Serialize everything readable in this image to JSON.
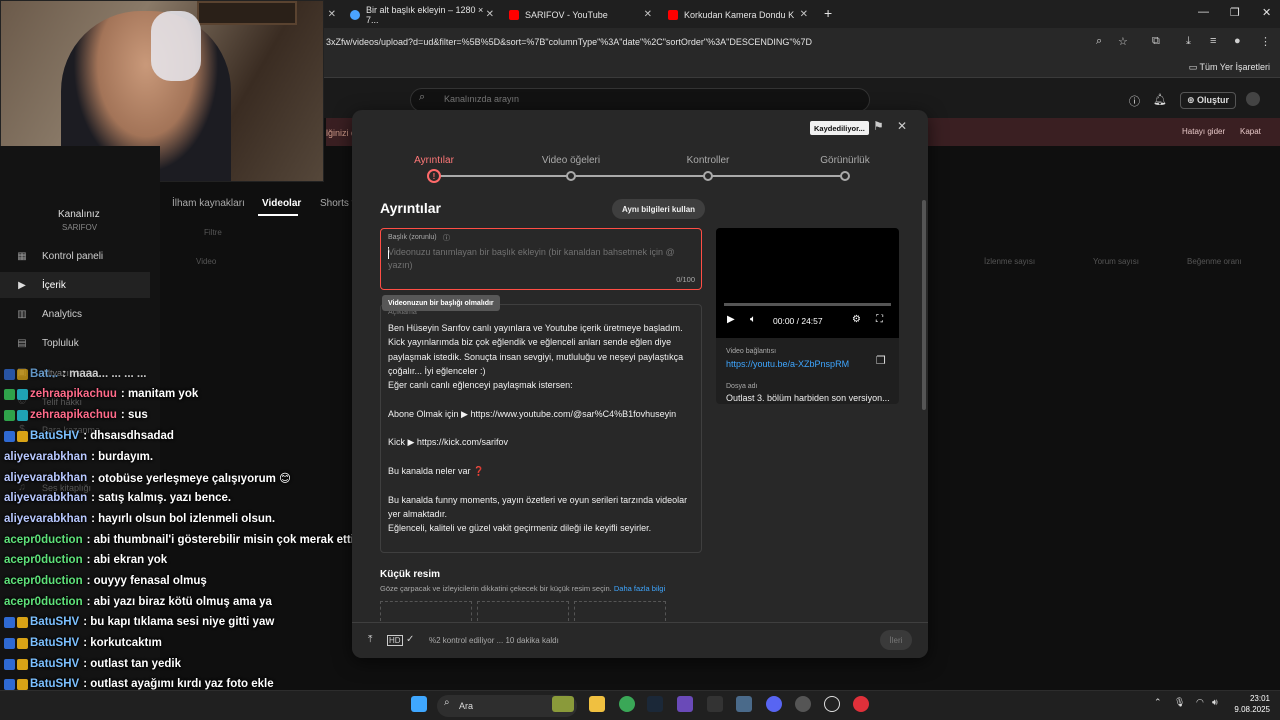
{
  "browser": {
    "tabs": [
      {
        "title": "Bir alt başlık ekleyin – 1280 × 7...",
        "fav_color": "#4aa3ff"
      },
      {
        "title": "SARIFOV - YouTube",
        "fav_color": "#ff0000"
      },
      {
        "title": "Korkudan Kamera Dondu Klavy...",
        "fav_color": "#ff0000"
      }
    ],
    "url": "3xZfw/videos/upload?d=ud&filter=%5B%5D&sort=%7B\"columnType\"%3A\"date\"%2C\"sortOrder\"%3A\"DESCENDING\"%7D",
    "bookmarks_all": "Tüm Yer İşaretleri"
  },
  "studio": {
    "search_placeholder": "Kanalınızda arayın",
    "create_label": "Oluştur",
    "banner_text": "lğinizi d",
    "banner_fix": "Hatayı gider",
    "banner_close": "Kapat",
    "channel_title": "Kanalınız",
    "channel_name": "SARIFOV",
    "content_tabs": [
      "İlham kaynakları",
      "Videolar",
      "Shorts v"
    ],
    "filter": "Filtre",
    "table_headers": [
      "Video",
      "İzlenme sayısı",
      "Yorum sayısı",
      "Beğenme oranı"
    ],
    "sidebar": [
      {
        "label": "Kontrol paneli"
      },
      {
        "label": "İçerik"
      },
      {
        "label": "Analytics"
      },
      {
        "label": "Topluluk"
      },
      {
        "label": "Altyazı ve ses"
      },
      {
        "label": "Telif hakkı"
      },
      {
        "label": "Para kazanma"
      },
      {
        "label": "Ses kitaplığı"
      }
    ]
  },
  "chat": [
    {
      "user": "Bat...",
      "msg": ": maaa... ... ... ..."
    },
    {
      "user": "zehraapikachuu",
      "msg": ": manitam yok"
    },
    {
      "user": "zehraapikachuu",
      "msg": ": sus"
    },
    {
      "user": "BatuSHV",
      "msg": ": dhsaısdhsadad"
    },
    {
      "user": "aliyevarabkhan",
      "msg": ": burdayım."
    },
    {
      "user": "aliyevarabkhan",
      "msg": ": otobüse yerleşmeye çalışıyorum 😊"
    },
    {
      "user": "aliyevarabkhan",
      "msg": ": satış kalmış. yazı bence."
    },
    {
      "user": "aliyevarabkhan",
      "msg": ": hayırlı olsun bol izlenmeli olsun."
    },
    {
      "user": "acepr0duction",
      "msg": ": abi thumbnail'i gösterebilir misin çok merak ettim"
    },
    {
      "user": "acepr0duction",
      "msg": ": abi ekran yok"
    },
    {
      "user": "acepr0duction",
      "msg": ": ouyyy fenasal olmuş"
    },
    {
      "user": "acepr0duction",
      "msg": ": abi yazı biraz kötü olmuş ama ya"
    },
    {
      "user": "BatuSHV",
      "msg": ": bu kapı tıklama sesi niye gitti yaw"
    },
    {
      "user": "BatuSHV",
      "msg": ": korkutcaktım"
    },
    {
      "user": "BatuSHV",
      "msg": ": outlast tan yedik"
    },
    {
      "user": "BatuSHV",
      "msg": ": outlast ayağımı kırdı yaz foto ekle"
    }
  ],
  "modal": {
    "saving_badge": "Kaydediliyor...",
    "steps": [
      "Ayrıntılar",
      "Video öğeleri",
      "Kontroller",
      "Görünürlük"
    ],
    "heading": "Ayrıntılar",
    "reuse_button": "Aynı bilgileri kullan",
    "title_field": {
      "label": "Başlık (zorunlu)",
      "placeholder": "Videonuzu tanımlayan bir başlık ekleyin (bir kanaldan bahsetmek için @ yazın)",
      "count": "0/100"
    },
    "title_error_tooltip": "Videonuzun bir başlığı olmalıdır",
    "description_label": "Açıklama",
    "description_text": "Ben Hüseyin Sarıfov canlı yayınlara ve Youtube içerik üretmeye başladım. Kick yayınlarımda biz çok eğlendik ve eğlenceli anları sende eğlen diye paylaşmak istedik. Sonuçta insan sevgiyi, mutluluğu ve neşeyi paylaştıkça çoğalır... İyi eğlenceler :)\nEğer canlı canlı eğlenceyi paylaşmak istersen:\n\nAbone Olmak için ▶ https://www.youtube.com/@sar%C4%B1fovhuseyin\n\nKick ▶ https://kick.com/sarifov\n\nBu kanalda neler var ❓\n\nBu kanalda funny moments, yayın özetleri ve oyun serileri tarzında videolar yer almaktadır.\nEğlenceli, kaliteli ve güzel vakit geçirmeniz dileği ile keyifli seyirler.",
    "video": {
      "time": "00:00 / 24:57",
      "link_label": "Video bağlantısı",
      "link": "https://youtu.be/a-XZbPnspRM",
      "file_label": "Dosya adı",
      "file_name": "Outlast 3. bölüm harbiden son versiyon..."
    },
    "thumbnail": {
      "title": "Küçük resim",
      "desc": "Göze çarpacak ve izleyicilerin dikkatini çekecek bir küçük resim seçin.",
      "more_link": "Daha fazla bilgi"
    },
    "footer_status": "%2 kontrol ediliyor ... 10 dakika kaldı",
    "next_button": "İleri"
  },
  "taskbar": {
    "search": "Ara",
    "time": "23:01",
    "date": "9.08.2025"
  }
}
